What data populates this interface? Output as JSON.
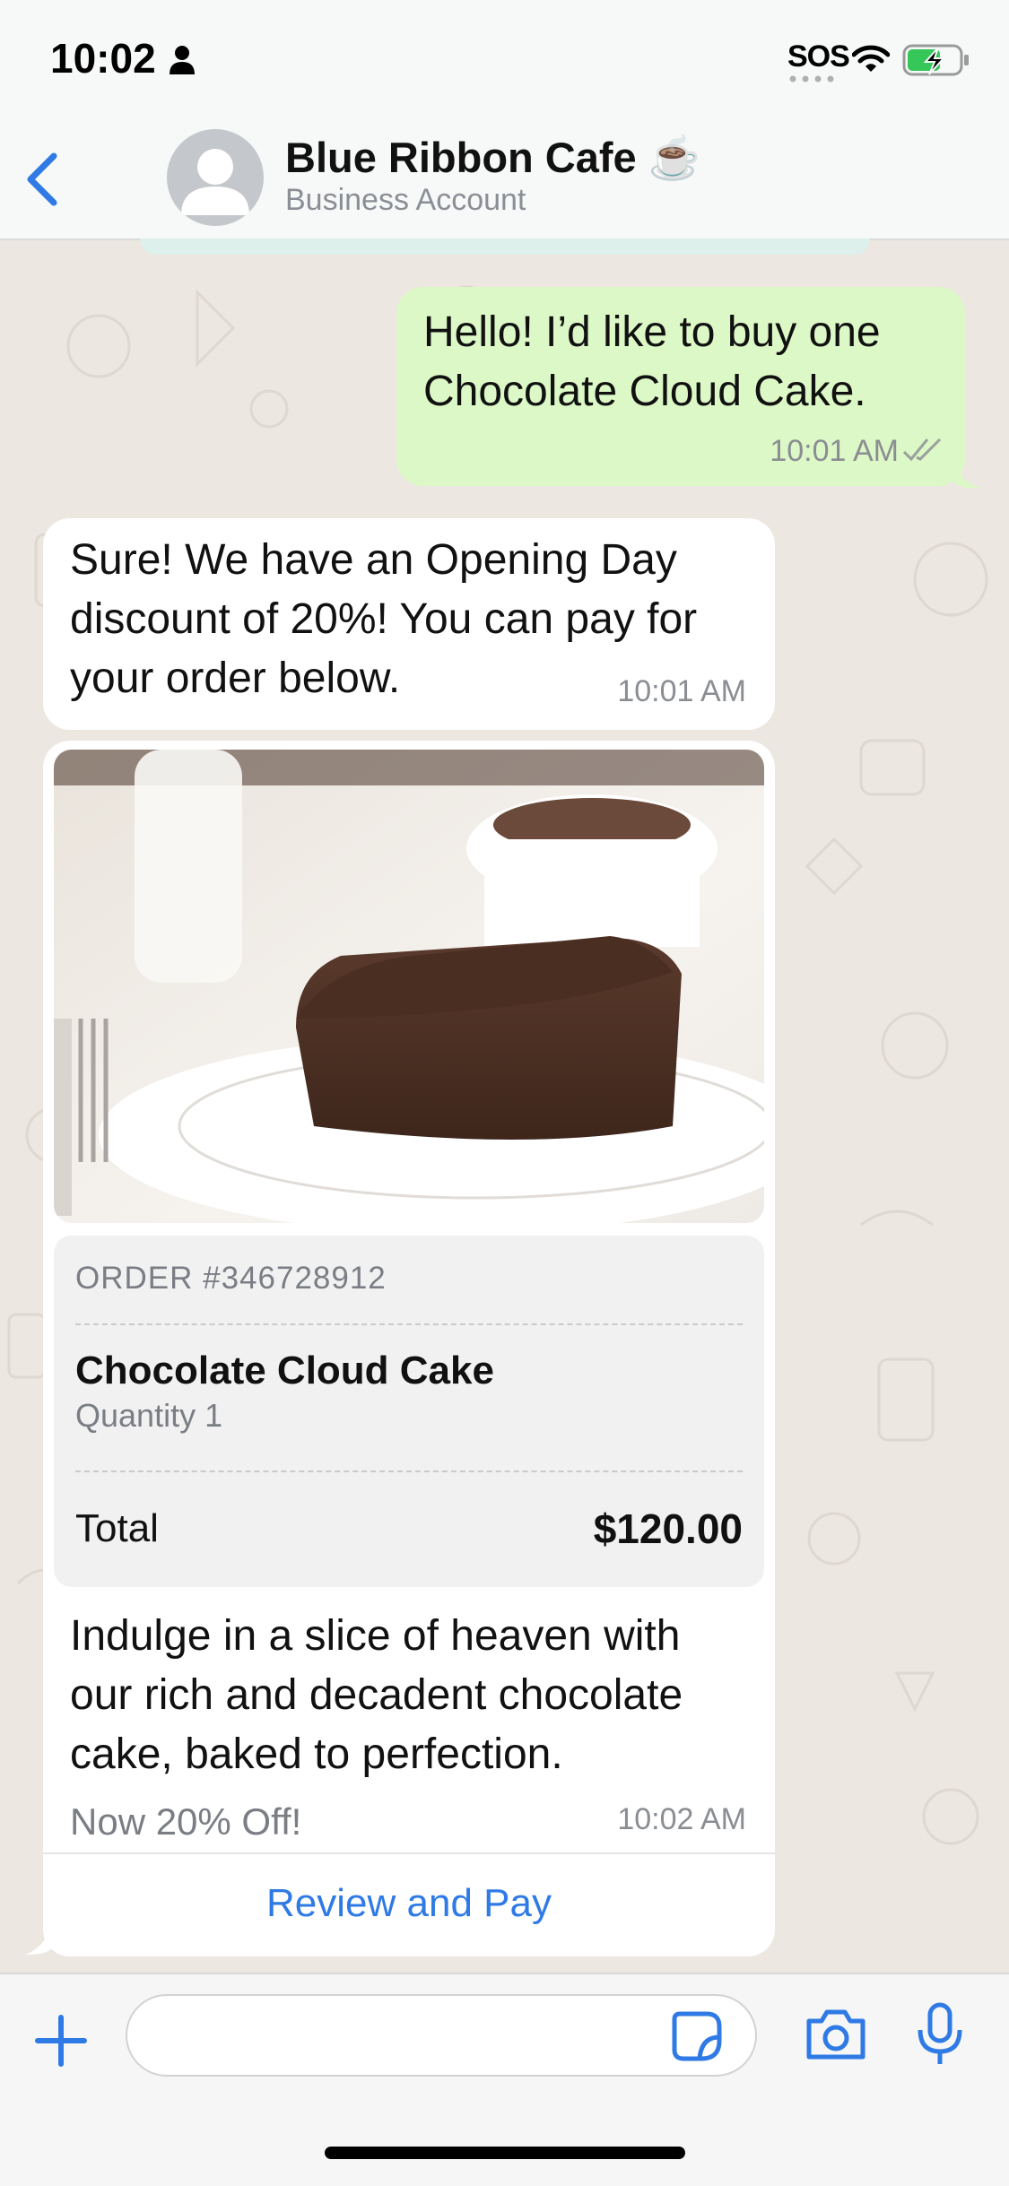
{
  "status_bar": {
    "time": "10:02",
    "sos": "SOS"
  },
  "header": {
    "title": "Blue Ribbon Cafe ☕",
    "subtitle": "Business Account"
  },
  "messages": {
    "outgoing": {
      "text": "Hello! I’d like to buy one Chocolate Cloud Cake.",
      "time": "10:01 AM"
    },
    "incoming": {
      "text": "Sure! We have an Opening Day discount of 20%! You can pay for your order below.",
      "time": "10:01 AM"
    }
  },
  "order_card": {
    "order_number": "ORDER #346728912",
    "item_name": "Chocolate Cloud Cake",
    "quantity": "Quantity 1",
    "total_label": "Total",
    "total_value": "$120.00",
    "description": "Indulge in a slice of heaven with our rich and decadent chocolate cake, baked to perfection.",
    "promo": "Now 20% Off!",
    "time": "10:02 AM",
    "button_label": "Review and Pay"
  },
  "input": {
    "placeholder": ""
  },
  "colors": {
    "accent": "#2F7AE5",
    "outgoing_bubble": "#DCF8C6",
    "incoming_bubble": "#FFFFFF",
    "chat_background": "#ECE7E0"
  },
  "icons": {
    "back": "chevron-left-icon",
    "avatar": "person-placeholder-icon",
    "plus": "plus-icon",
    "sticker": "sticker-icon",
    "camera": "camera-icon",
    "mic": "microphone-icon"
  }
}
